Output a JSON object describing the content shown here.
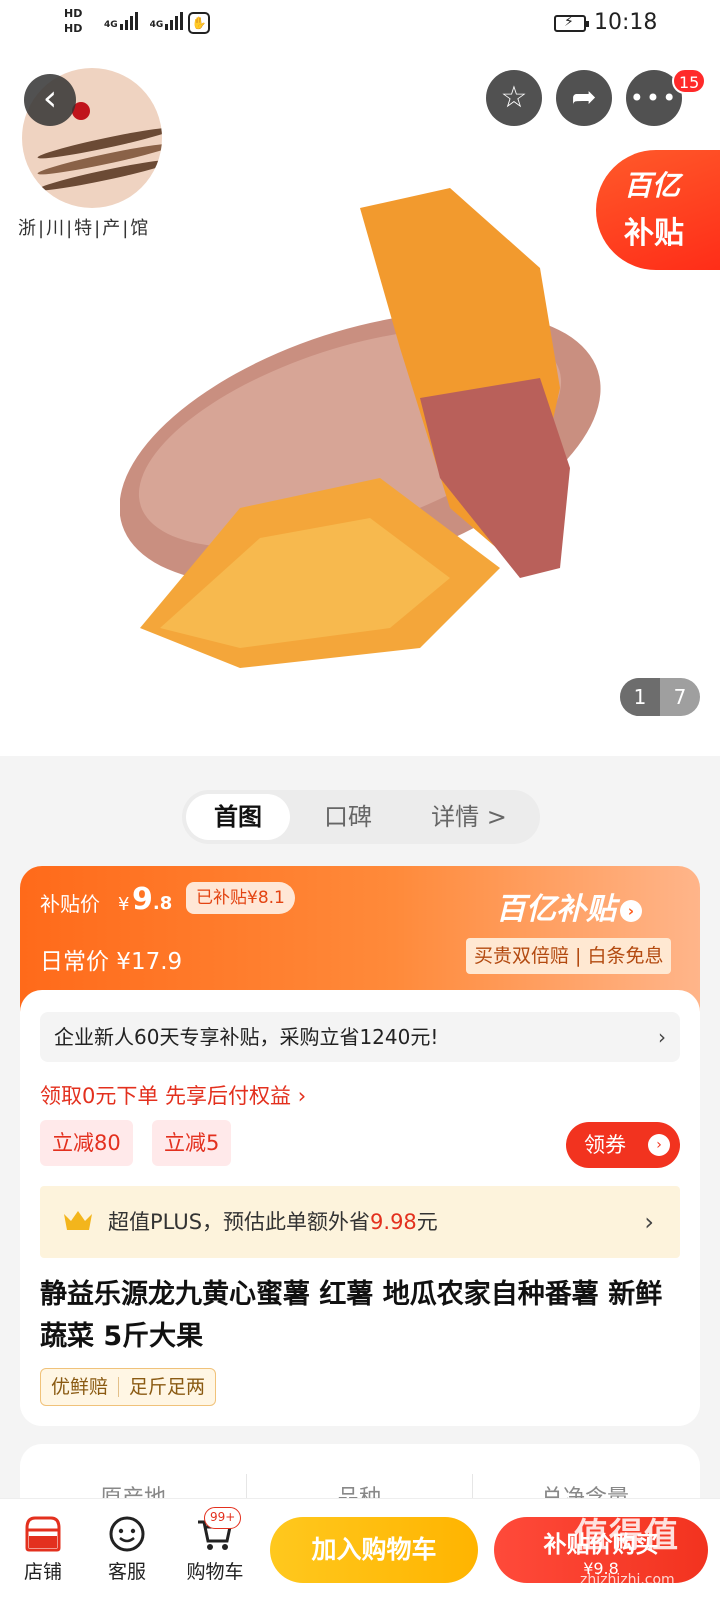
{
  "status_bar": {
    "hd1": "HD",
    "hd2": "HD",
    "net1": "4G",
    "net2": "4G",
    "time": "10:18"
  },
  "hero": {
    "store_logo_text": "浙|川|特|产|馆",
    "notification_count": "15",
    "subsidy_tag_line1": "百亿",
    "subsidy_tag_line2": "补贴",
    "pager_current": "1",
    "pager_total": "7"
  },
  "tabs": [
    {
      "label": "首图"
    },
    {
      "label": "口碑"
    },
    {
      "label": "详情 >"
    }
  ],
  "price": {
    "subsidy_label": "补贴价",
    "currency": "¥",
    "price_int": "9",
    "price_dec": ".8",
    "saved_label": "已补贴¥8.1",
    "regular_label": "日常价 ¥17.9",
    "brand": "百亿补贴",
    "guarantee": "买贵双倍赔 | 白条免息"
  },
  "offers": {
    "newbie": "企业新人60天专享补贴，采购立省1240元!",
    "pay_later": "领取0元下单 先享后付权益 ›",
    "coupon1": "立减80",
    "coupon2": "立减5",
    "get_coupon": "领券",
    "plus_prefix": "超值PLUS，预估此单额外省",
    "plus_amount": "9.98",
    "plus_suffix": "元"
  },
  "product": {
    "title": "静益乐源龙九黄心蜜薯 红薯 地瓜农家自种番薯 新鲜蔬菜 5斤大果",
    "tag1": "优鲜赔",
    "tag2": "足斤足两"
  },
  "specs": [
    {
      "label": "原产地"
    },
    {
      "label": "品种"
    },
    {
      "label": "总净含量"
    }
  ],
  "bottom_bar": {
    "shop": "店铺",
    "service": "客服",
    "cart": "购物车",
    "cart_badge": "99+",
    "add_to_cart": "加入购物车",
    "buy_now": "补贴价购买",
    "buy_now_price": "¥9.8"
  },
  "watermark": {
    "text": "值得值",
    "sub": "zhizhizhi.com"
  },
  "colors": {
    "accent_red": "#f2331f",
    "accent_orange": "#ff6a1a",
    "accent_yellow": "#ffb400"
  }
}
